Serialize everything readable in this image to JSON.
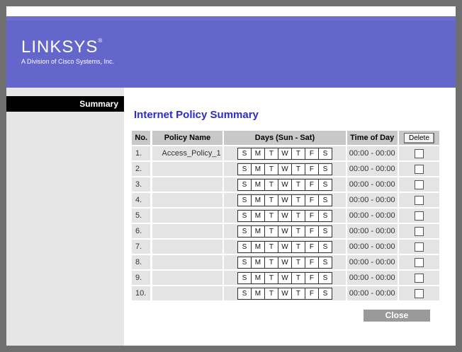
{
  "brand": {
    "logo": "LINKSYS",
    "logo_mark": "®",
    "tagline": "A Division of Cisco Systems, Inc."
  },
  "sidebar": {
    "items": [
      {
        "label": "Summary"
      }
    ]
  },
  "page": {
    "title": "Internet Policy Summary"
  },
  "table": {
    "headers": {
      "no": "No.",
      "name": "Policy Name",
      "days": "Days (Sun - Sat)",
      "time": "Time of Day",
      "delete": "Delete"
    },
    "day_letters": [
      "S",
      "M",
      "T",
      "W",
      "T",
      "F",
      "S"
    ],
    "rows": [
      {
        "no": "1.",
        "name": "Access_Policy_1",
        "time": "00:00 - 00:00"
      },
      {
        "no": "2.",
        "name": "",
        "time": "00:00 - 00:00"
      },
      {
        "no": "3.",
        "name": "",
        "time": "00:00 - 00:00"
      },
      {
        "no": "4.",
        "name": "",
        "time": "00:00 - 00:00"
      },
      {
        "no": "5.",
        "name": "",
        "time": "00:00 - 00:00"
      },
      {
        "no": "6.",
        "name": "",
        "time": "00:00 - 00:00"
      },
      {
        "no": "7.",
        "name": "",
        "time": "00:00 - 00:00"
      },
      {
        "no": "8.",
        "name": "",
        "time": "00:00 - 00:00"
      },
      {
        "no": "9.",
        "name": "",
        "time": "00:00 - 00:00"
      },
      {
        "no": "10.",
        "name": "",
        "time": "00:00 - 00:00"
      }
    ]
  },
  "footer": {
    "close_label": "Close"
  },
  "colors": {
    "header": "#6466cc",
    "title": "#2b2bcc",
    "sidebar_active": "#000000"
  }
}
